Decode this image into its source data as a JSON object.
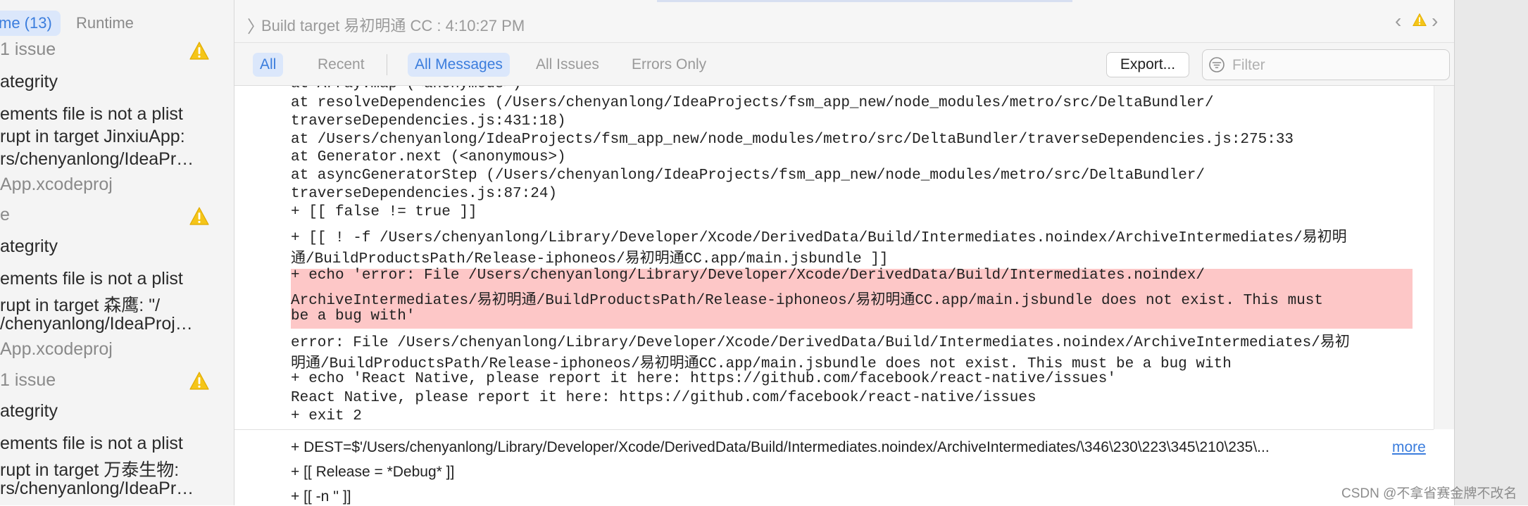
{
  "sidebar": {
    "tabs": [
      {
        "label": "me (13)",
        "selected": true
      },
      {
        "label": "Runtime",
        "selected": false
      }
    ],
    "groups": [
      {
        "header": "1 issue",
        "category": "ategrity",
        "msg1": "ements file is not a plist",
        "msg2": "rupt in target JinxiuApp:",
        "msg3": "rs/chenyanlong/IdeaPr…",
        "project": "App.xcodeproj"
      },
      {
        "header": "e",
        "category": "ategrity",
        "msg1": "ements file is not a plist",
        "msg2": "rupt in target 森鹰: \"/",
        "msg3": "/chenyanlong/IdeaProj…",
        "project": "App.xcodeproj"
      },
      {
        "header": "1 issue",
        "category": "ategrity",
        "msg1": "ements file is not a plist",
        "msg2": "rupt in target 万泰生物:",
        "msg3": "rs/chenyanlong/IdeaPr…"
      }
    ],
    "warning_color": "#f5c518"
  },
  "titlebar": {
    "title": "Build target 易初明通 CC : 4:10:27 PM"
  },
  "filterbar": {
    "all": "All",
    "recent": "Recent",
    "all_messages": "All Messages",
    "all_issues": "All Issues",
    "errors_only": "Errors Only",
    "export": "Export...",
    "filter_placeholder": "Filter"
  },
  "log": {
    "lines": [
      "    at Array.map (<anonymous>)",
      "    at resolveDependencies (/Users/chenyanlong/IdeaProjects/fsm_app_new/node_modules/metro/src/DeltaBundler/",
      "  traverseDependencies.js:431:18)",
      "    at /Users/chenyanlong/IdeaProjects/fsm_app_new/node_modules/metro/src/DeltaBundler/traverseDependencies.js:275:33",
      "    at Generator.next (<anonymous>)",
      "    at asyncGeneratorStep (/Users/chenyanlong/IdeaProjects/fsm_app_new/node_modules/metro/src/DeltaBundler/",
      "  traverseDependencies.js:87:24)",
      "+ [[ false != true ]]",
      "+ [[ ! -f /Users/chenyanlong/Library/Developer/Xcode/DerivedData/Build/Intermediates.noindex/ArchiveIntermediates/易初明",
      "  通/BuildProductsPath/Release-iphoneos/易初明通CC.app/main.jsbundle ]]",
      "+ echo 'error: File /Users/chenyanlong/Library/Developer/Xcode/DerivedData/Build/Intermediates.noindex/",
      "  ArchiveIntermediates/易初明通/BuildProductsPath/Release-iphoneos/易初明通CC.app/main.jsbundle does not exist. This must",
      "  be a bug with'",
      "error: File /Users/chenyanlong/Library/Developer/Xcode/DerivedData/Build/Intermediates.noindex/ArchiveIntermediates/易初",
      "  明通/BuildProductsPath/Release-iphoneos/易初明通CC.app/main.jsbundle does not exist. This must be a bug with",
      "+ echo 'React Native, please report it here: https://github.com/facebook/react-native/issues'",
      "React Native, please report it here: https://github.com/facebook/react-native/issues",
      "+ exit 2"
    ],
    "highlight_color": "#fdc7c7"
  },
  "transcript": {
    "lines": [
      "+ DEST=$'/Users/chenyanlong/Library/Developer/Xcode/DerivedData/Build/Intermediates.noindex/ArchiveIntermediates/\\346\\230\\223\\345\\210\\235\\...",
      "+ [[ Release = *Debug* ]]",
      "+ [[ -n '' ]]"
    ],
    "more": "more"
  },
  "watermark": "CSDN @不拿省赛金牌不改名"
}
